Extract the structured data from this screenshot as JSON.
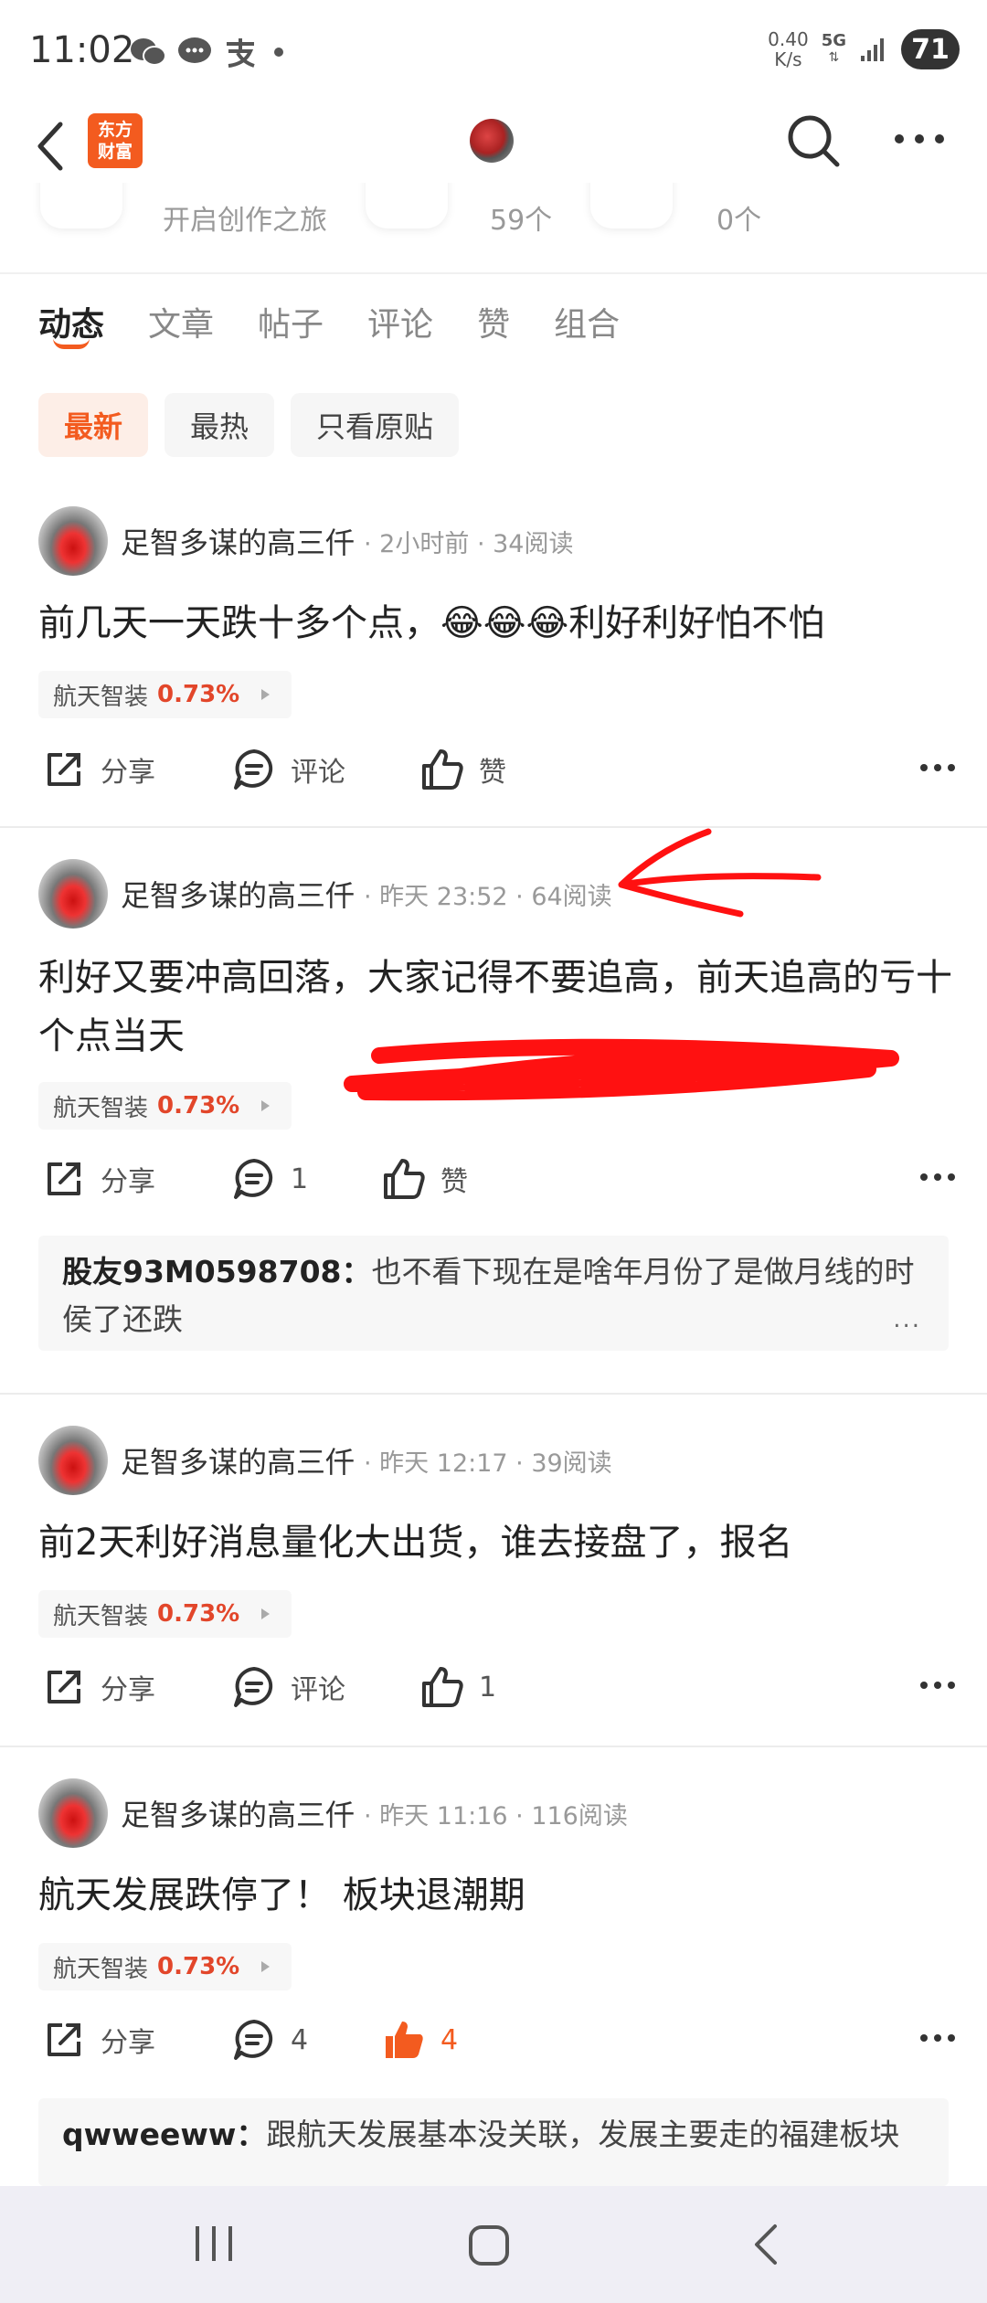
{
  "status_bar": {
    "time": "11:02",
    "speed_value": "0.40",
    "speed_unit": "K/s",
    "network": "5G",
    "battery": "71"
  },
  "nav": {
    "logo_line1": "东方",
    "logo_line2": "财富"
  },
  "stats": {
    "item1": "开启创作之旅",
    "item2": "59个",
    "item3": "0个"
  },
  "tabs": [
    "动态",
    "文章",
    "帖子",
    "评论",
    "赞",
    "组合"
  ],
  "filters": [
    "最新",
    "最热",
    "只看原贴"
  ],
  "posts": [
    {
      "author": "足智多谋的高三仟",
      "meta": "· 2小时前 · 34阅读",
      "text": "前几天一天跌十多个点，😂😂😂利好利好怕不怕",
      "stock": "航天智装",
      "pct": "0.73%",
      "share": "分享",
      "comment": "评论",
      "like": "赞"
    },
    {
      "author": "足智多谋的高三仟",
      "meta": "· 昨天 23:52 · 64阅读",
      "text": "利好又要冲高回落，大家记得不要追高，前天追高的亏十个点当天",
      "stock": "航天智装",
      "pct": "0.73%",
      "share": "分享",
      "comment": "1",
      "like": "赞",
      "reply_user": "股友93M0598708",
      "reply_sep": "：",
      "reply_text": "也不看下现在是啥年月份了是做月线的时侯了还跌",
      "reply_more": "..."
    },
    {
      "author": "足智多谋的高三仟",
      "meta": "· 昨天 12:17 · 39阅读",
      "text": "前2天利好消息量化大出货，谁去接盘了，报名",
      "stock": "航天智装",
      "pct": "0.73%",
      "share": "分享",
      "comment": "评论",
      "like": "1"
    },
    {
      "author": "足智多谋的高三仟",
      "meta": "· 昨天 11:16 · 116阅读",
      "text": "航天发展跌停了！ 板块退潮期",
      "stock": "航天智装",
      "pct": "0.73%",
      "share": "分享",
      "comment": "4",
      "like": "4",
      "reply_user": "qwweeww",
      "reply_sep": "：",
      "reply_text": "跟航天发展基本没关联，发展主要走的福建板块"
    }
  ],
  "colors": {
    "accent": "#f35b1f",
    "stock_up": "#e2462a",
    "annotation": "#ff1111"
  }
}
